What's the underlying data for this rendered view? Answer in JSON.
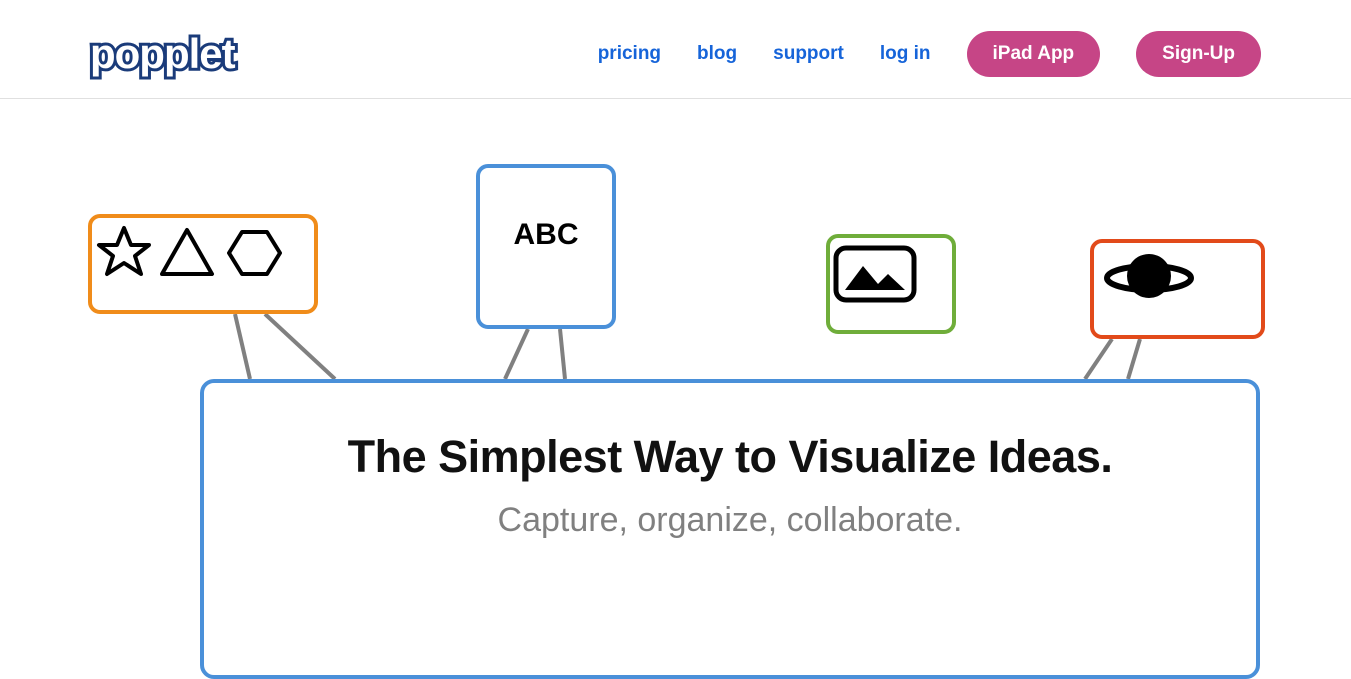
{
  "brand": "popplet",
  "nav": {
    "pricing": "pricing",
    "blog": "blog",
    "support": "support",
    "login": "log in",
    "ipad": "iPad App",
    "signup": "Sign-Up"
  },
  "cards": {
    "abc": "ABC"
  },
  "hero": {
    "headline": "The Simplest Way to Visualize Ideas.",
    "subline": "Capture, organize, collaborate."
  }
}
